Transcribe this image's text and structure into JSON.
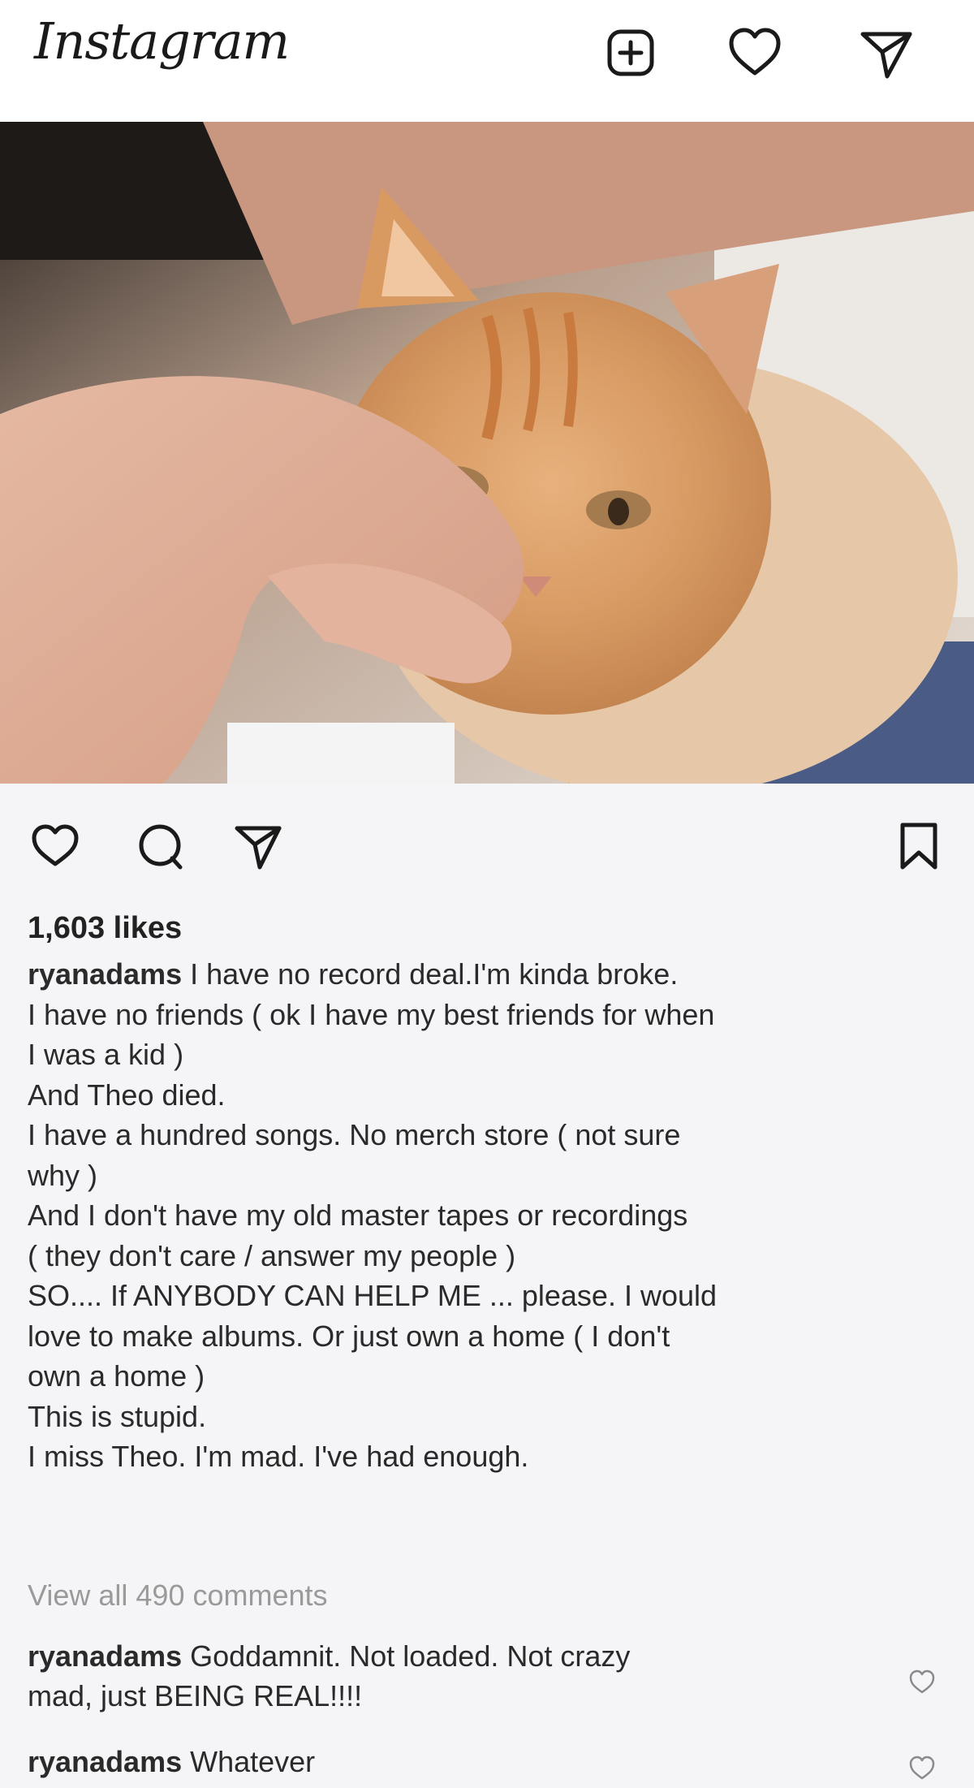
{
  "app": {
    "logo": "Instagram",
    "header_icons": [
      "plus-square-icon",
      "heart-icon",
      "send-icon"
    ]
  },
  "post": {
    "image_alt": "orange kitten held by a hand",
    "action_icons": [
      "heart-icon",
      "comment-icon",
      "send-icon",
      "bookmark-icon"
    ],
    "likes": "1,603 likes",
    "author": "ryanadams",
    "caption_lines": [
      " I have no record deal.I'm kinda broke.",
      "I have no friends ( ok I have my best friends for when",
      "I was a kid )",
      "And Theo died.",
      "I have a hundred songs. No merch store ( not sure",
      "why )",
      "And I don't have my old master tapes or recordings",
      "( they don't care / answer my people )",
      "SO.... If ANYBODY CAN HELP ME ... please.  I would",
      "love to make albums. Or just own a home ( I don't",
      "own a home )",
      "This is stupid.",
      "I miss Theo. I'm mad. I've had enough."
    ],
    "view_all_comments": "View all 490 comments",
    "comments": [
      {
        "user": "ryanadams",
        "text": " Goddamnit. Not loaded. Not crazy",
        "text2": "mad, just BEING REAL!!!!"
      },
      {
        "user": "ryanadams",
        "text": " Whatever"
      }
    ]
  },
  "colors": {
    "background": "#f5f5f7",
    "text": "#222222",
    "muted": "#9a9a9a"
  }
}
